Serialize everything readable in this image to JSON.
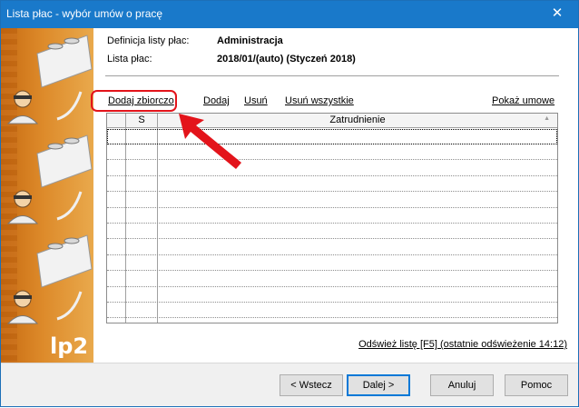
{
  "window": {
    "title": "Lista płac - wybór umów o pracę",
    "close_glyph": "✕"
  },
  "banner": {
    "logo": "lp2"
  },
  "info": {
    "definition_label": "Definicja listy płac:",
    "definition_value": "Administracja",
    "list_label": "Lista płac:",
    "list_value": "2018/01/(auto) (Styczeń 2018)"
  },
  "toolbar": {
    "add_bulk": "Dodaj zbiorczo",
    "add": "Dodaj",
    "remove": "Usuń",
    "remove_all": "Usuń wszystkie",
    "show_contract": "Pokaż umowe"
  },
  "grid": {
    "columns": [
      "",
      "S",
      "Zatrudnienie"
    ],
    "sort_indicator": "▲",
    "rows": 12
  },
  "refresh": "Odśwież listę [F5] (ostatnie odświeżenie 14:12)",
  "buttons": {
    "back": "< Wstecz",
    "next": "Dalej >",
    "cancel": "Anuluj",
    "help": "Pomoc"
  },
  "colors": {
    "titlebar": "#1979ca",
    "annotation": "#e3141b",
    "banner": "#dd8a2a"
  }
}
